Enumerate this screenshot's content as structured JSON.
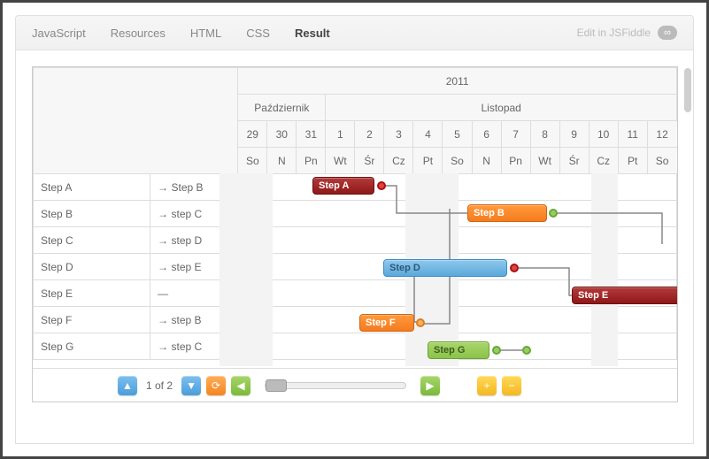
{
  "header": {
    "tabs": [
      "JavaScript",
      "Resources",
      "HTML",
      "CSS",
      "Result"
    ],
    "active_index": 4,
    "edit_label": "Edit in JSFiddle"
  },
  "gantt": {
    "year": "2011",
    "months": [
      {
        "name": "Październik",
        "span": 3
      },
      {
        "name": "Listopad",
        "span": 14
      }
    ],
    "day_numbers": [
      "29",
      "30",
      "31",
      "1",
      "2",
      "3",
      "4",
      "5",
      "6",
      "7",
      "8",
      "9",
      "10",
      "11",
      "12"
    ],
    "day_names": [
      "So",
      "N",
      "Pn",
      "Wt",
      "Śr",
      "Cz",
      "Pt",
      "So",
      "N",
      "Pn",
      "Wt",
      "Śr",
      "Cz",
      "Pt",
      "So"
    ],
    "rows": [
      {
        "name": "Step A",
        "dep": "→ Step B"
      },
      {
        "name": "Step B",
        "dep": "→ step C"
      },
      {
        "name": "Step C",
        "dep": "→ step D"
      },
      {
        "name": "Step D",
        "dep": "→ step E"
      },
      {
        "name": "Step E",
        "dep": "—"
      },
      {
        "name": "Step F",
        "dep": "→ step B"
      },
      {
        "name": "Step G",
        "dep": "→ step C"
      }
    ],
    "bars": {
      "a": "Step A",
      "b": "Step B",
      "d": "Step D",
      "e": "Step E",
      "f": "Step F",
      "g": "Step G"
    }
  },
  "footer": {
    "page_label": "1 of 2"
  }
}
